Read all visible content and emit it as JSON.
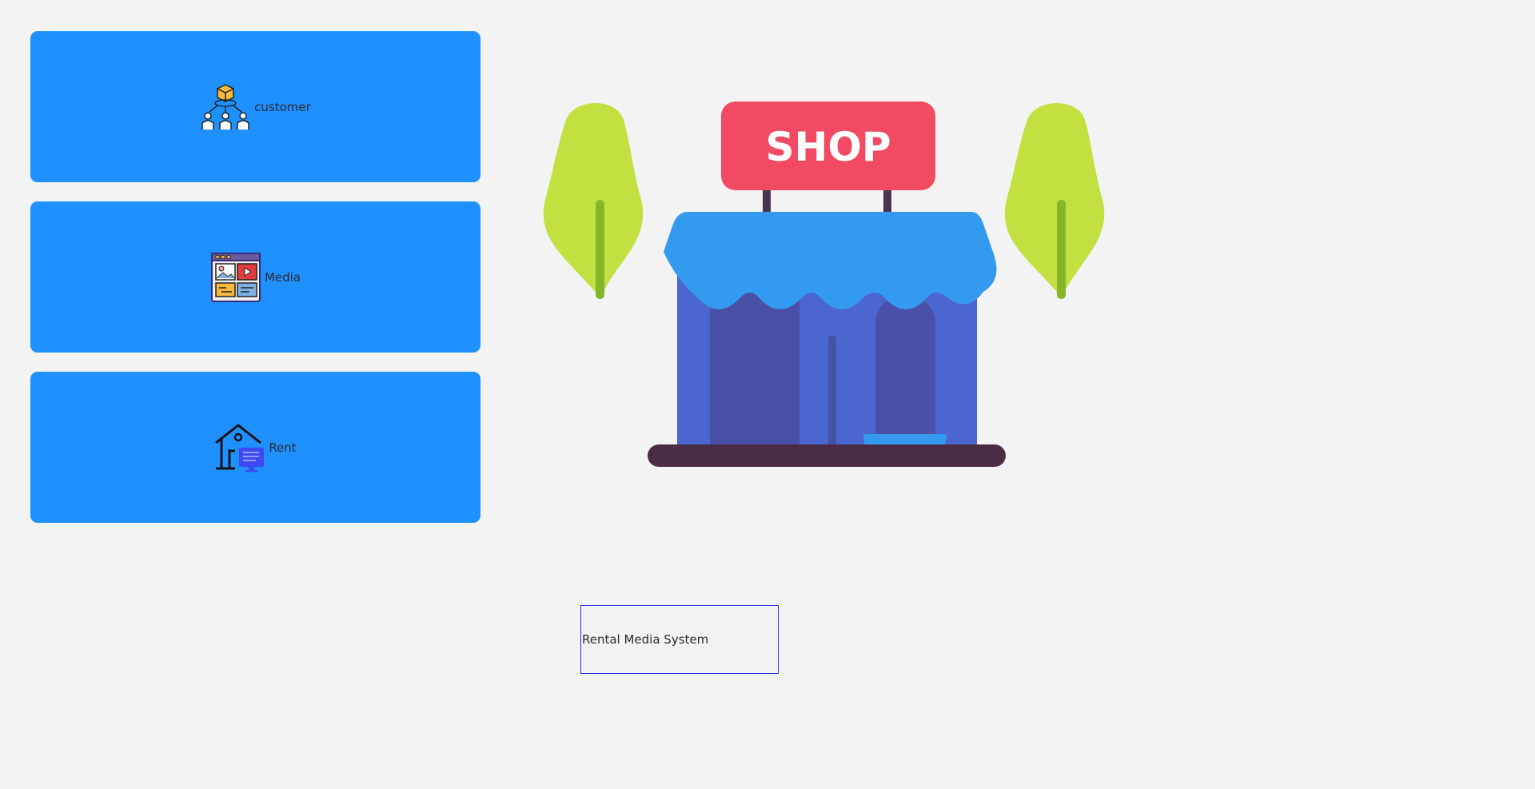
{
  "sidebar": {
    "items": [
      {
        "label": "customer",
        "icon": "customer-network-icon"
      },
      {
        "label": "Media",
        "icon": "media-window-icon"
      },
      {
        "label": "Rent",
        "icon": "rent-house-monitor-icon"
      }
    ]
  },
  "illustration": {
    "sign_text": "SHOP",
    "icon": "shop-storefront-illustration"
  },
  "app": {
    "title": "Rental Media System"
  },
  "colors": {
    "button_bg": "#1e90ff",
    "page_bg": "#f3f3f3",
    "title_border": "#2a2ae0",
    "sign": "#f14a62",
    "awning": "#339af0",
    "building": "#4b66cf",
    "tree": "#c3e041"
  }
}
